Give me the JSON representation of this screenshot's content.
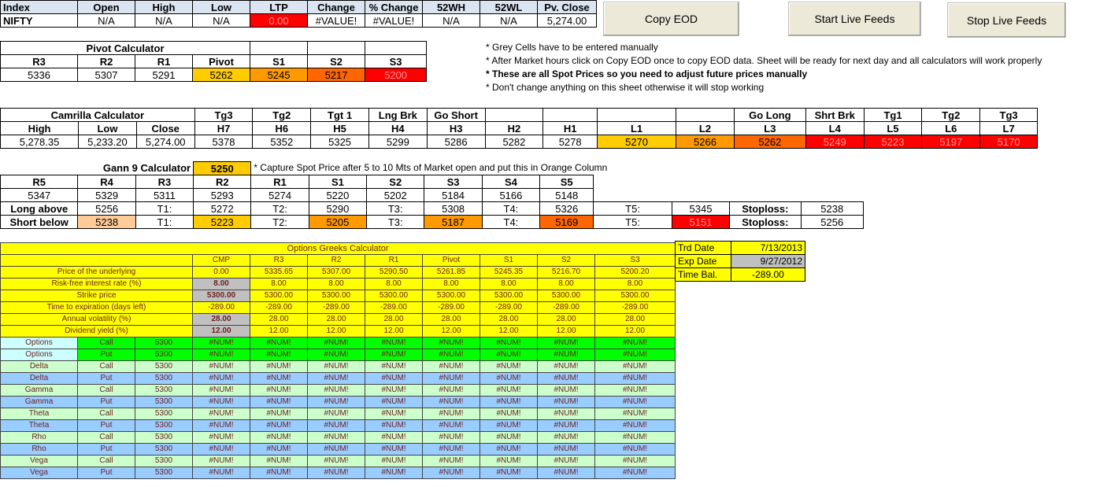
{
  "buttons": {
    "copy_eod": "Copy EOD",
    "start_live": "Start Live Feeds",
    "stop_live": "Stop Live Feeds"
  },
  "index_table": {
    "headers": [
      "Index",
      "Open",
      "High",
      "Low",
      "LTP",
      "Change",
      "% Change",
      "52WH",
      "52WL",
      "Pv. Close"
    ],
    "row": [
      "NIFTY",
      "N/A",
      "N/A",
      "N/A",
      "0.00",
      "#VALUE!",
      "#VALUE!",
      "N/A",
      "N/A",
      "5,274.00"
    ]
  },
  "notes": [
    "* Grey Cells have to be entered manually",
    "* After Market hours click on Copy EOD once to copy EOD data. Sheet will be ready for next day and all calculators will work properly",
    "* These are all Spot Prices so you need to adjust future prices manually",
    "* Don't change anything on this sheet otherwise it will stop working"
  ],
  "pivot": {
    "title": "Pivot Calculator",
    "headers": [
      "R3",
      "R2",
      "R1",
      "Pivot",
      "S1",
      "S2",
      "S3"
    ],
    "values": [
      "5336",
      "5307",
      "5291",
      "5262",
      "5245",
      "5217",
      "5200"
    ]
  },
  "camrilla": {
    "title": "Camrilla Calculator",
    "top_labels": [
      "Tg3",
      "Tg2",
      "Tgt 1",
      "Lng Brk",
      "Go Short",
      "",
      "",
      "",
      "",
      "Go Long",
      "Shrt Brk",
      "Tg1",
      "Tg2",
      "Tg3"
    ],
    "headers": [
      "High",
      "Low",
      "Close",
      "H7",
      "H6",
      "H5",
      "H4",
      "H3",
      "H2",
      "H1",
      "L1",
      "L2",
      "L3",
      "L4",
      "L5",
      "L6",
      "L7"
    ],
    "values": [
      "5,278.35",
      "5,233.20",
      "5,274.00",
      "5378",
      "5352",
      "5325",
      "5299",
      "5286",
      "5282",
      "5278",
      "5270",
      "5266",
      "5262",
      "5249",
      "5223",
      "5197",
      "5170"
    ]
  },
  "gann": {
    "title": "Gann 9 Calculator",
    "input": "5250",
    "note": "* Capture Spot Price after 5 to 10 Mts of Market open and put this in Orange Column",
    "headers": [
      "R5",
      "R4",
      "R3",
      "R2",
      "R1",
      "S1",
      "S2",
      "S3",
      "S4",
      "S5"
    ],
    "values": [
      "5347",
      "5329",
      "5311",
      "5293",
      "5274",
      "5220",
      "5202",
      "5184",
      "5166",
      "5148"
    ],
    "long": {
      "label": "Long above",
      "entry": "5256",
      "t1l": "T1:",
      "t1": "5272",
      "t2l": "T2:",
      "t2": "5290",
      "t3l": "T3:",
      "t3": "5308",
      "t4l": "T4:",
      "t4": "5326",
      "t5l": "T5:",
      "t5": "5345",
      "sll": "Stoploss:",
      "sl": "5238"
    },
    "short": {
      "label": "Short below",
      "entry": "5238",
      "t1l": "T1:",
      "t1": "5223",
      "t2l": "T2:",
      "t2": "5205",
      "t3l": "T3:",
      "t3": "5187",
      "t4l": "T4:",
      "t4": "5169",
      "t5l": "T5:",
      "t5": "5151",
      "sll": "Stoploss:",
      "sl": "5256"
    }
  },
  "greeks": {
    "title": "Options Greeks Calculator",
    "headers": [
      "CMP",
      "R3",
      "R2",
      "R1",
      "Pivot",
      "S1",
      "S2",
      "S3"
    ],
    "params": [
      {
        "label": "Price of the underlying",
        "values": [
          "0.00",
          "5335.65",
          "5307.00",
          "5290.50",
          "5261.85",
          "5245.35",
          "5216.70",
          "5200.20"
        ]
      },
      {
        "label": "Risk-free interest rate (%)",
        "values": [
          "8.00",
          "8.00",
          "8.00",
          "8.00",
          "8.00",
          "8.00",
          "8.00",
          "8.00"
        ]
      },
      {
        "label": "Strike price",
        "values": [
          "5300.00",
          "5300.00",
          "5300.00",
          "5300.00",
          "5300.00",
          "5300.00",
          "5300.00",
          "5300.00"
        ]
      },
      {
        "label": "Time to expiration (days left)",
        "values": [
          "-289.00",
          "-289.00",
          "-289.00",
          "-289.00",
          "-289.00",
          "-289.00",
          "-289.00",
          "-289.00"
        ]
      },
      {
        "label": "Annual volatility (%)",
        "values": [
          "28.00",
          "28.00",
          "28.00",
          "28.00",
          "28.00",
          "28.00",
          "28.00",
          "28.00"
        ]
      },
      {
        "label": "Dividend yield (%)",
        "values": [
          "12.00",
          "12.00",
          "12.00",
          "12.00",
          "12.00",
          "12.00",
          "12.00",
          "12.00"
        ]
      }
    ],
    "rows": [
      {
        "name": "Options",
        "type": "Call",
        "strike": "5300",
        "val": "#NUM!"
      },
      {
        "name": "Options",
        "type": "Put",
        "strike": "5300",
        "val": "#NUM!"
      },
      {
        "name": "Delta",
        "type": "Call",
        "strike": "5300",
        "val": "#NUM!"
      },
      {
        "name": "Delta",
        "type": "Put",
        "strike": "5300",
        "val": "#NUM!"
      },
      {
        "name": "Gamma",
        "type": "Call",
        "strike": "5300",
        "val": "#NUM!"
      },
      {
        "name": "Gamma",
        "type": "Put",
        "strike": "5300",
        "val": "#NUM!"
      },
      {
        "name": "Theta",
        "type": "Call",
        "strike": "5300",
        "val": "#NUM!"
      },
      {
        "name": "Theta",
        "type": "Put",
        "strike": "5300",
        "val": "#NUM!"
      },
      {
        "name": "Rho",
        "type": "Call",
        "strike": "5300",
        "val": "#NUM!"
      },
      {
        "name": "Rho",
        "type": "Put",
        "strike": "5300",
        "val": "#NUM!"
      },
      {
        "name": "Vega",
        "type": "Call",
        "strike": "5300",
        "val": "#NUM!"
      },
      {
        "name": "Vega",
        "type": "Put",
        "strike": "5300",
        "val": "#NUM!"
      }
    ]
  },
  "dates": [
    {
      "label": "Trd Date",
      "value": "7/13/2013"
    },
    {
      "label": "Exp Date",
      "value": "9/27/2012"
    },
    {
      "label": "Time Bal.",
      "value": "-289.00"
    }
  ]
}
